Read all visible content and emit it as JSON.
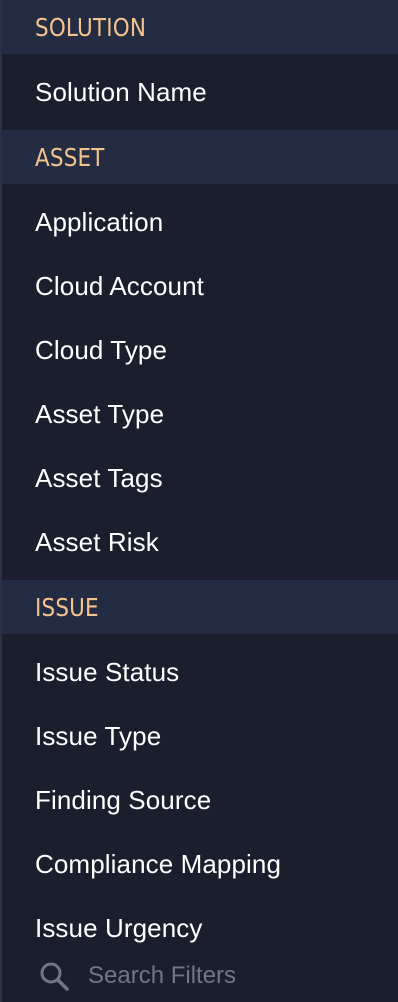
{
  "colors": {
    "panel_bg": "#1b1f2d",
    "header_bg": "#242c43",
    "header_text": "#f4c28c",
    "item_text": "#ffffff",
    "placeholder": "#6f7687"
  },
  "sections": [
    {
      "title": "SOLUTION",
      "items": [
        "Solution Name"
      ]
    },
    {
      "title": "ASSET",
      "items": [
        "Application",
        "Cloud Account",
        "Cloud Type",
        "Asset Type",
        "Asset Tags",
        "Asset Risk"
      ]
    },
    {
      "title": "ISSUE",
      "items": [
        "Issue Status",
        "Issue Type",
        "Finding Source",
        "Compliance Mapping",
        "Issue Urgency"
      ]
    }
  ],
  "search": {
    "icon": "search-icon",
    "value": "",
    "placeholder": "Search Filters"
  }
}
